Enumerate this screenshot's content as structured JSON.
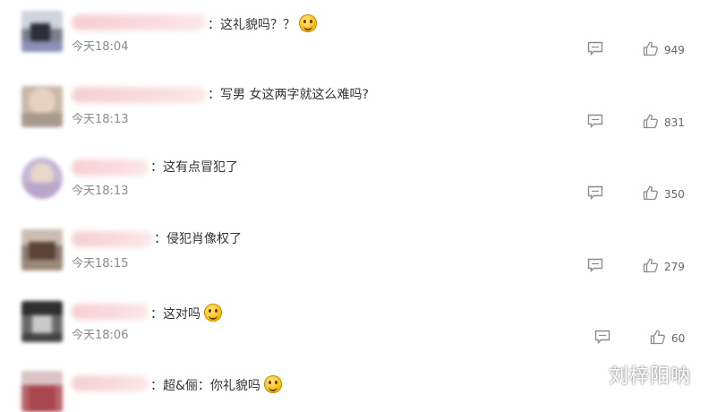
{
  "comments": [
    {
      "text": "：这礼貌吗？？",
      "time": "今天18:04",
      "likes": "949",
      "emoji": "laugh-cry-emoji"
    },
    {
      "text": "：写男 女这两字就这么难吗?",
      "time": "今天18:13",
      "likes": "831"
    },
    {
      "text": "：这有点冒犯了",
      "time": "今天18:13",
      "likes": "350"
    },
    {
      "text": "：侵犯肖像权了",
      "time": "今天18:15",
      "likes": "279"
    },
    {
      "text": "：这对吗",
      "time": "今天18:06",
      "likes": "60",
      "emoji": "sweat-smile-emoji"
    },
    {
      "text": "：超&俪：你礼貌吗",
      "emoji": "smile-emoji"
    }
  ],
  "watermark": "刘梓阳呐",
  "colors": {
    "username_blur": "#f6cfd2",
    "time": "#8a8a8a",
    "icon": "#8c8c8c"
  },
  "icons": {
    "reply": "comment-icon",
    "like": "thumbs-up-icon"
  }
}
